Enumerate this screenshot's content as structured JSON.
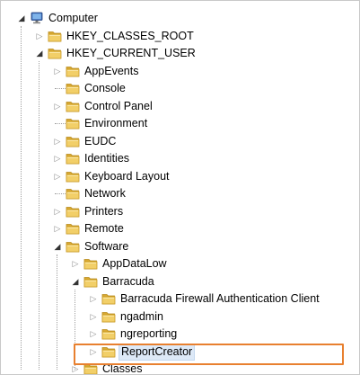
{
  "tree": [
    {
      "label": "Computer",
      "level": 0,
      "state": "expanded",
      "icon": "computer-icon"
    },
    {
      "label": "HKEY_CLASSES_ROOT",
      "level": 1,
      "state": "collapsed",
      "icon": "folder-icon"
    },
    {
      "label": "HKEY_CURRENT_USER",
      "level": 1,
      "state": "expanded",
      "icon": "folder-icon"
    },
    {
      "label": "AppEvents",
      "level": 2,
      "state": "collapsed",
      "icon": "folder-icon"
    },
    {
      "label": "Console",
      "level": 2,
      "state": "leaf",
      "icon": "folder-icon"
    },
    {
      "label": "Control Panel",
      "level": 2,
      "state": "collapsed",
      "icon": "folder-icon"
    },
    {
      "label": "Environment",
      "level": 2,
      "state": "leaf",
      "icon": "folder-icon"
    },
    {
      "label": "EUDC",
      "level": 2,
      "state": "collapsed",
      "icon": "folder-icon"
    },
    {
      "label": "Identities",
      "level": 2,
      "state": "collapsed",
      "icon": "folder-icon"
    },
    {
      "label": "Keyboard Layout",
      "level": 2,
      "state": "collapsed",
      "icon": "folder-icon"
    },
    {
      "label": "Network",
      "level": 2,
      "state": "leaf",
      "icon": "folder-icon"
    },
    {
      "label": "Printers",
      "level": 2,
      "state": "collapsed",
      "icon": "folder-icon"
    },
    {
      "label": "Remote",
      "level": 2,
      "state": "collapsed",
      "icon": "folder-icon"
    },
    {
      "label": "Software",
      "level": 2,
      "state": "expanded",
      "icon": "folder-icon"
    },
    {
      "label": "AppDataLow",
      "level": 3,
      "state": "collapsed",
      "icon": "folder-icon"
    },
    {
      "label": "Barracuda",
      "level": 3,
      "state": "expanded",
      "icon": "folder-icon"
    },
    {
      "label": "Barracuda Firewall Authentication Client",
      "level": 4,
      "state": "collapsed",
      "icon": "folder-icon"
    },
    {
      "label": "ngadmin",
      "level": 4,
      "state": "collapsed",
      "icon": "folder-icon"
    },
    {
      "label": "ngreporting",
      "level": 4,
      "state": "collapsed",
      "icon": "folder-icon"
    },
    {
      "label": "ReportCreator",
      "level": 4,
      "state": "collapsed",
      "icon": "folder-icon",
      "selected": true
    },
    {
      "label": "Classes",
      "level": 3,
      "state": "collapsed",
      "icon": "folder-icon"
    }
  ],
  "colors": {
    "highlight": "#e8802f",
    "folder": "#e9c35a",
    "selection": "#dde9f7"
  }
}
